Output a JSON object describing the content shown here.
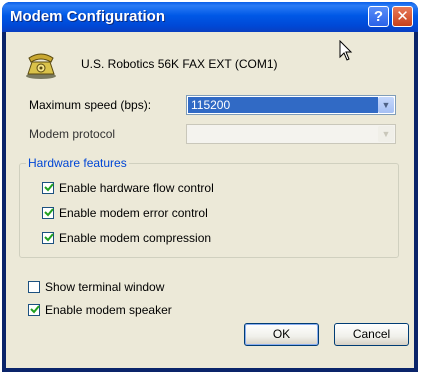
{
  "window": {
    "title": "Modem Configuration",
    "help_glyph": "?",
    "close_glyph": "✕"
  },
  "device": {
    "name": "U.S. Robotics 56K FAX EXT (COM1)",
    "icon": "modem-phone-icon"
  },
  "max_speed": {
    "label": "Maximum speed (bps):",
    "value": "115200",
    "arrow": "▼"
  },
  "protocol": {
    "label": "Modem protocol",
    "value": "",
    "arrow": "▼"
  },
  "hardware": {
    "title": "Hardware features",
    "items": [
      {
        "label": "Enable hardware flow control",
        "checked": true
      },
      {
        "label": "Enable modem error control",
        "checked": true
      },
      {
        "label": "Enable modem compression",
        "checked": true
      }
    ]
  },
  "options": [
    {
      "label": "Show terminal window",
      "checked": false
    },
    {
      "label": "Enable modem speaker",
      "checked": true
    }
  ],
  "buttons": {
    "ok": "OK",
    "cancel": "Cancel"
  }
}
